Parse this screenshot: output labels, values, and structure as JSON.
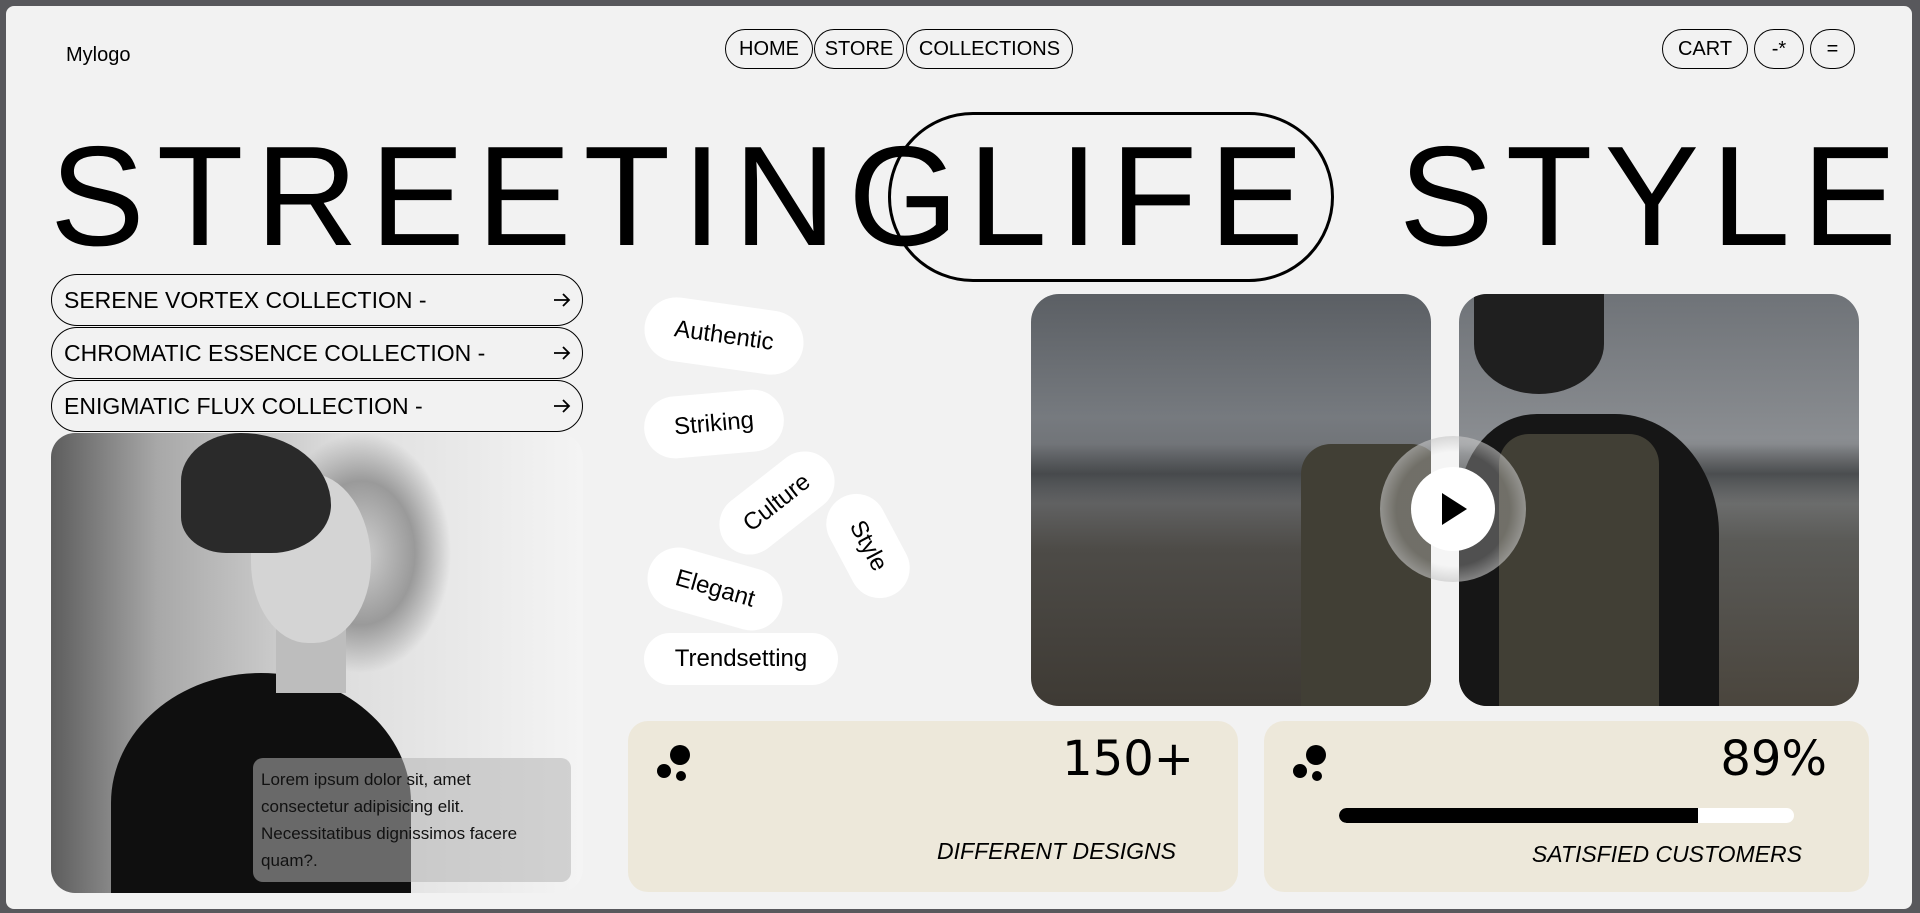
{
  "header": {
    "logo": "Mylogo",
    "nav": [
      "HOME",
      "STORE",
      "COLLECTIONS"
    ],
    "cart": "CART",
    "icon_button_1": "-*",
    "icon_button_2": "="
  },
  "hero": {
    "word1": "STREETING",
    "word2": "LIFE",
    "word3": "STYLE"
  },
  "collections": [
    "SERENE VORTEX COLLECTION -",
    "CHROMATIC ESSENCE COLLECTION -",
    "ENIGMATIC FLUX COLLECTION -"
  ],
  "image_caption": "Lorem ipsum dolor sit, amet consectetur adipisicing elit. Necessitatibus dignissimos facere quam?.",
  "tags": [
    "Authentic",
    "Striking",
    "Culture",
    "Style",
    "Elegant",
    "Trendsetting"
  ],
  "stats": [
    {
      "value": "150+",
      "label": "DIFFERENT DESIGNS"
    },
    {
      "value": "89%",
      "label": "SATISFIED CUSTOMERS",
      "progress": 0.79
    }
  ],
  "icons": {
    "collection_arrow": "arrow-right-icon",
    "play": "play-icon",
    "stat_icon": "three-dots-icon"
  }
}
